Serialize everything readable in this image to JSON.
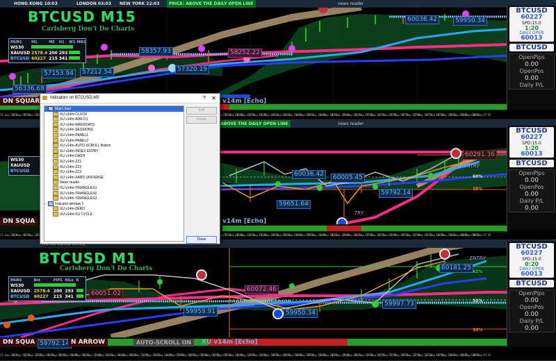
{
  "pane1": {
    "cities": [
      "HONG KONG 10:03",
      "LONDON 03:03",
      "NEW YORK 22:03"
    ],
    "price_banner": "PRICE: ABOVE THE DAILY OPEN LINE",
    "news": "news reader",
    "title": "BTCUSD M15",
    "subtitle": "Carlsberg Don't Do Charts",
    "labels": [
      "58357.93",
      "58252.22",
      "57212.54",
      "57320.19",
      "57153.94",
      "56336.68",
      "60036.42",
      "59950.34"
    ],
    "dn_label": "DN SQUARE",
    "echo": "v14m [Echo]"
  },
  "pane2": {
    "news": "news reader",
    "labels": [
      "60036.42",
      "60005.45",
      "59792.14",
      "59651.64",
      "60291.36"
    ],
    "xentry": "X ENTRY",
    "pct_60": "60%",
    "pct_38": "38%",
    "dn_label": "DN SQUA",
    "echo": "v14m [Echo]",
    "try": "TRY"
  },
  "pane3": {
    "title": "BTCUSD M1",
    "subtitle": "Carlsberg Don't Do Charts",
    "labels": [
      "60051.02",
      "60072.46",
      "59959.91",
      "59950.34",
      "59997.73",
      "60181.25",
      "59792.14"
    ],
    "entry": "ENTRY",
    "pct_62": "62%",
    "pct_50": "50%",
    "pct_38": "38%",
    "dn_label": "DN SQUA",
    "arrow_label": "N ARROW",
    "autoscroll": "AUTO-SCROLL ON",
    "echo": "XU v14m [Echo]"
  },
  "corr": {
    "headers": [
      "PAIRS",
      "Bid",
      "PIPS",
      "HiLo",
      "K"
    ],
    "cols": [
      "M1",
      "M5",
      "M15",
      "H1",
      "D1",
      "W1",
      "MN1"
    ],
    "rows": [
      {
        "pair": "WS30",
        "bid": "",
        "pips": "",
        "hilo": "",
        "k": ""
      },
      {
        "pair": "XAUUSD",
        "bid": "2578.4",
        "pips": "200",
        "hilo": "293",
        "k": ""
      },
      {
        "pair": "BTCUSD",
        "bid": "60227",
        "pips": "215",
        "hilo": "341",
        "k": ""
      }
    ],
    "rows3": [
      {
        "pair": "WS30",
        "bid": "",
        "pips": "",
        "hilo": "",
        "k": ""
      },
      {
        "pair": "XAUUSD",
        "bid": "2578.4",
        "pips": "200",
        "hilo": "293",
        "k": ""
      },
      {
        "pair": "BTCUSD",
        "bid": "60227",
        "pips": "215",
        "hilo": "341",
        "k": ""
      }
    ]
  },
  "side": {
    "symbol": "BTCUSD",
    "price": "60227",
    "spd": "SPD:15.0",
    "timer1": "1:20",
    "timer3": "0:20",
    "daily_open": "DAILY OPEN",
    "daily_open_price": "60013",
    "open_pips_label": "OpenPips",
    "open_pips_value": "0.00",
    "open_pos_label": "OpenPos",
    "open_pos_value": "0.00",
    "daily_pl_label": "Daily P/L",
    "daily_pl_value": "0.00"
  },
  "dialog": {
    "title": "Indicators on BTCUSD,M5",
    "help": "?",
    "close_x": "✕",
    "main_chart": "Main chart",
    "items": [
      "XU v14m-CLOCK",
      "XU v14m-ADR D1",
      "XU v14m-WEEKDAYS",
      "XU v14m-SESSIONS",
      "XU v14m-PANEL1",
      "XU v14m-PANEL2",
      "XU v14m-AUTO-SCROLL Button",
      "XU v14m-INDEX ENTRY",
      "XU v14m-DASH",
      "XU v14m-ZZ1",
      "XU v14m-ZZ2",
      "XU v14m-ZZ3",
      "XU v14m-XARD UNIVERSE",
      "News reader",
      "XU v14m-TRIANGLES1",
      "XU v14m-TRIANGLES2",
      "XU v14m-TRIANGLES3"
    ],
    "window1": "Indicator window 1",
    "window_items": [
      "XU v14m-ZERO",
      "XU v14m-XU CYCLE"
    ],
    "btn_edit": "Edit",
    "btn_delete": "Delete",
    "btn_close": "Close"
  },
  "colors": {
    "sky": "#29a8ff",
    "pink": "#ff2d8a",
    "tan": "#a88f6a",
    "green_band": "#2fbf4a",
    "blue_line": "#2a3cff"
  },
  "xaxis": [
    "11 Sep 2024",
    "11 Sep 16:15",
    "11 Sep 17:45",
    "12 Sep 00:15",
    "12 Sep 03:45",
    "12 Sep 06:45",
    "12 Sep 09:15",
    "12 Sep 12:45",
    "13 Sep 01:15",
    "13 Sep 04:45",
    "13 Sep 08:15",
    "13 Sep 11:45",
    "13 Sep 15:15",
    "13 Sep 18:45",
    "14 Sep 00:45",
    "14 Sep 04:15",
    "14 Sep 08:45",
    "15 Sep 02:45",
    "15 Sep 05:15",
    "15 Sep 08:45",
    "15 Sep 12:15",
    "15 Sep 15:45",
    "15 Sep 19:15",
    "16 Sep 00:15",
    "16 Sep 03:45",
    "16 Sep 07:15",
    "16 Sep 10:45",
    "16 Sep 14:15",
    "16 Sep 17:45",
    "16 Sep 21:15",
    "16 Sep 23:45",
    "17 Sep 02:15",
    "17 Sep 05:45",
    "17 Sep 09:15",
    "17 Sep 12:45",
    "17 Sep 16:15",
    "17 Sep 19:45",
    "17 Sep 23:15",
    "18 Sep 01:45",
    "18 Sep 04:15",
    "18 Sep 07:45"
  ]
}
